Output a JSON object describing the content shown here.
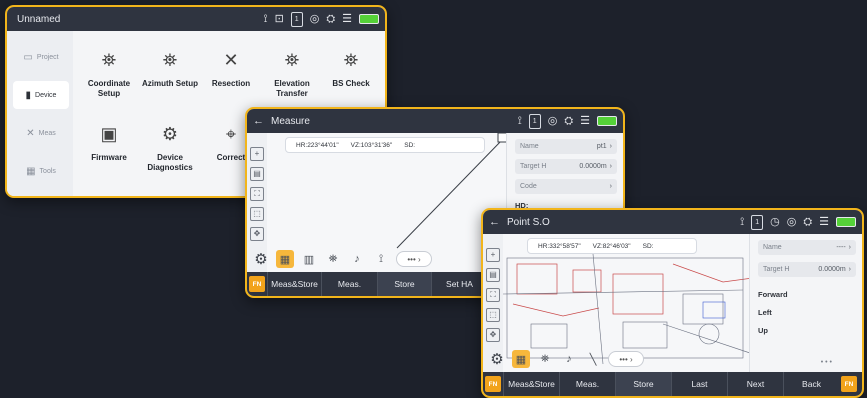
{
  "window1": {
    "title": "Unnamed",
    "sidebar": [
      {
        "label": "Project",
        "icon": "folder-icon"
      },
      {
        "label": "Device",
        "icon": "device-icon"
      },
      {
        "label": "Meas",
        "icon": "cross-icon"
      },
      {
        "label": "Tools",
        "icon": "grid-icon"
      }
    ],
    "tiles": [
      {
        "label": "Coordinate Setup",
        "glyph": "⛯"
      },
      {
        "label": "Azimuth Setup",
        "glyph": "⛯"
      },
      {
        "label": "Resection",
        "glyph": "✕"
      },
      {
        "label": "Elevation Transfer",
        "glyph": "⛯"
      },
      {
        "label": "BS Check",
        "glyph": "⛯"
      },
      {
        "label": "Firmware",
        "glyph": "▣"
      },
      {
        "label": "Device Diagnostics",
        "glyph": "⚙"
      },
      {
        "label": "Correct",
        "glyph": "⌖"
      }
    ]
  },
  "window2": {
    "title": "Measure",
    "readout": {
      "hr": "HR:223°44'01\"",
      "vz": "VZ:103°31'36\"",
      "sd": "SD:"
    },
    "panel": {
      "name_label": "Name",
      "name_value": "pt1",
      "target_label": "Target H",
      "target_value": "0.0000m",
      "code_label": "Code",
      "hd_label": "HD:"
    },
    "buttons": [
      "Meas&Store",
      "Meas.",
      "Store",
      "Set HA"
    ],
    "fn": "FN"
  },
  "window3": {
    "title": "Point S.O",
    "readout": {
      "hr": "HR:332°58'57\"",
      "vz": "VZ:82°46'03\"",
      "sd": "SD:"
    },
    "panel": {
      "name_label": "Name",
      "name_value": "----",
      "target_label": "Target H",
      "target_value": "0.0000m",
      "forward": "Forward",
      "left": "Left",
      "up": "Up"
    },
    "buttons": [
      "Meas&Store",
      "Meas.",
      "Store",
      "Last",
      "Next",
      "Back"
    ],
    "fn": "FN"
  },
  "colors": {
    "accent": "#f2b51b",
    "titlebar": "#2f3440",
    "background": "#1d212b"
  }
}
